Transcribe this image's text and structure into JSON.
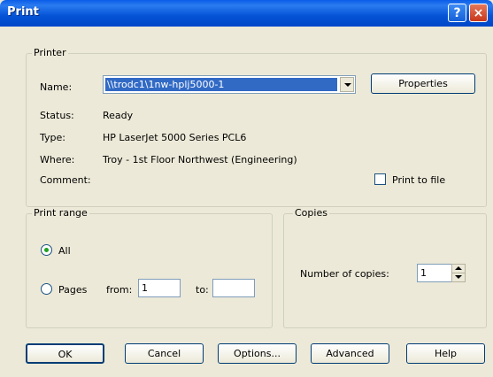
{
  "window": {
    "title": "Print",
    "help_glyph": "?",
    "close_glyph": "×"
  },
  "printer": {
    "group_label": "Printer",
    "name_label": "Name:",
    "name_value": "\\\\trodc1\\1nw-hplj5000-1",
    "properties_button": "Properties",
    "status_label": "Status:",
    "status_value": "Ready",
    "type_label": "Type:",
    "type_value": "HP LaserJet 5000 Series PCL6",
    "where_label": "Where:",
    "where_value": "Troy - 1st Floor Northwest (Engineering)",
    "comment_label": "Comment:",
    "print_to_file_label": "Print to file",
    "print_to_file_checked": false
  },
  "print_range": {
    "group_label": "Print range",
    "all_label": "All",
    "pages_label": "Pages",
    "from_label": "from:",
    "from_value": "1",
    "to_label": "to:",
    "to_value": "",
    "selected": "all"
  },
  "copies": {
    "group_label": "Copies",
    "number_label": "Number of copies:",
    "number_value": "1"
  },
  "buttons": {
    "ok": "OK",
    "cancel": "Cancel",
    "options": "Options...",
    "advanced": "Advanced",
    "help": "Help"
  },
  "colors": {
    "titlebar": "#0553d6",
    "dialog_bg": "#ece9d8",
    "selection": "#316ac5"
  }
}
